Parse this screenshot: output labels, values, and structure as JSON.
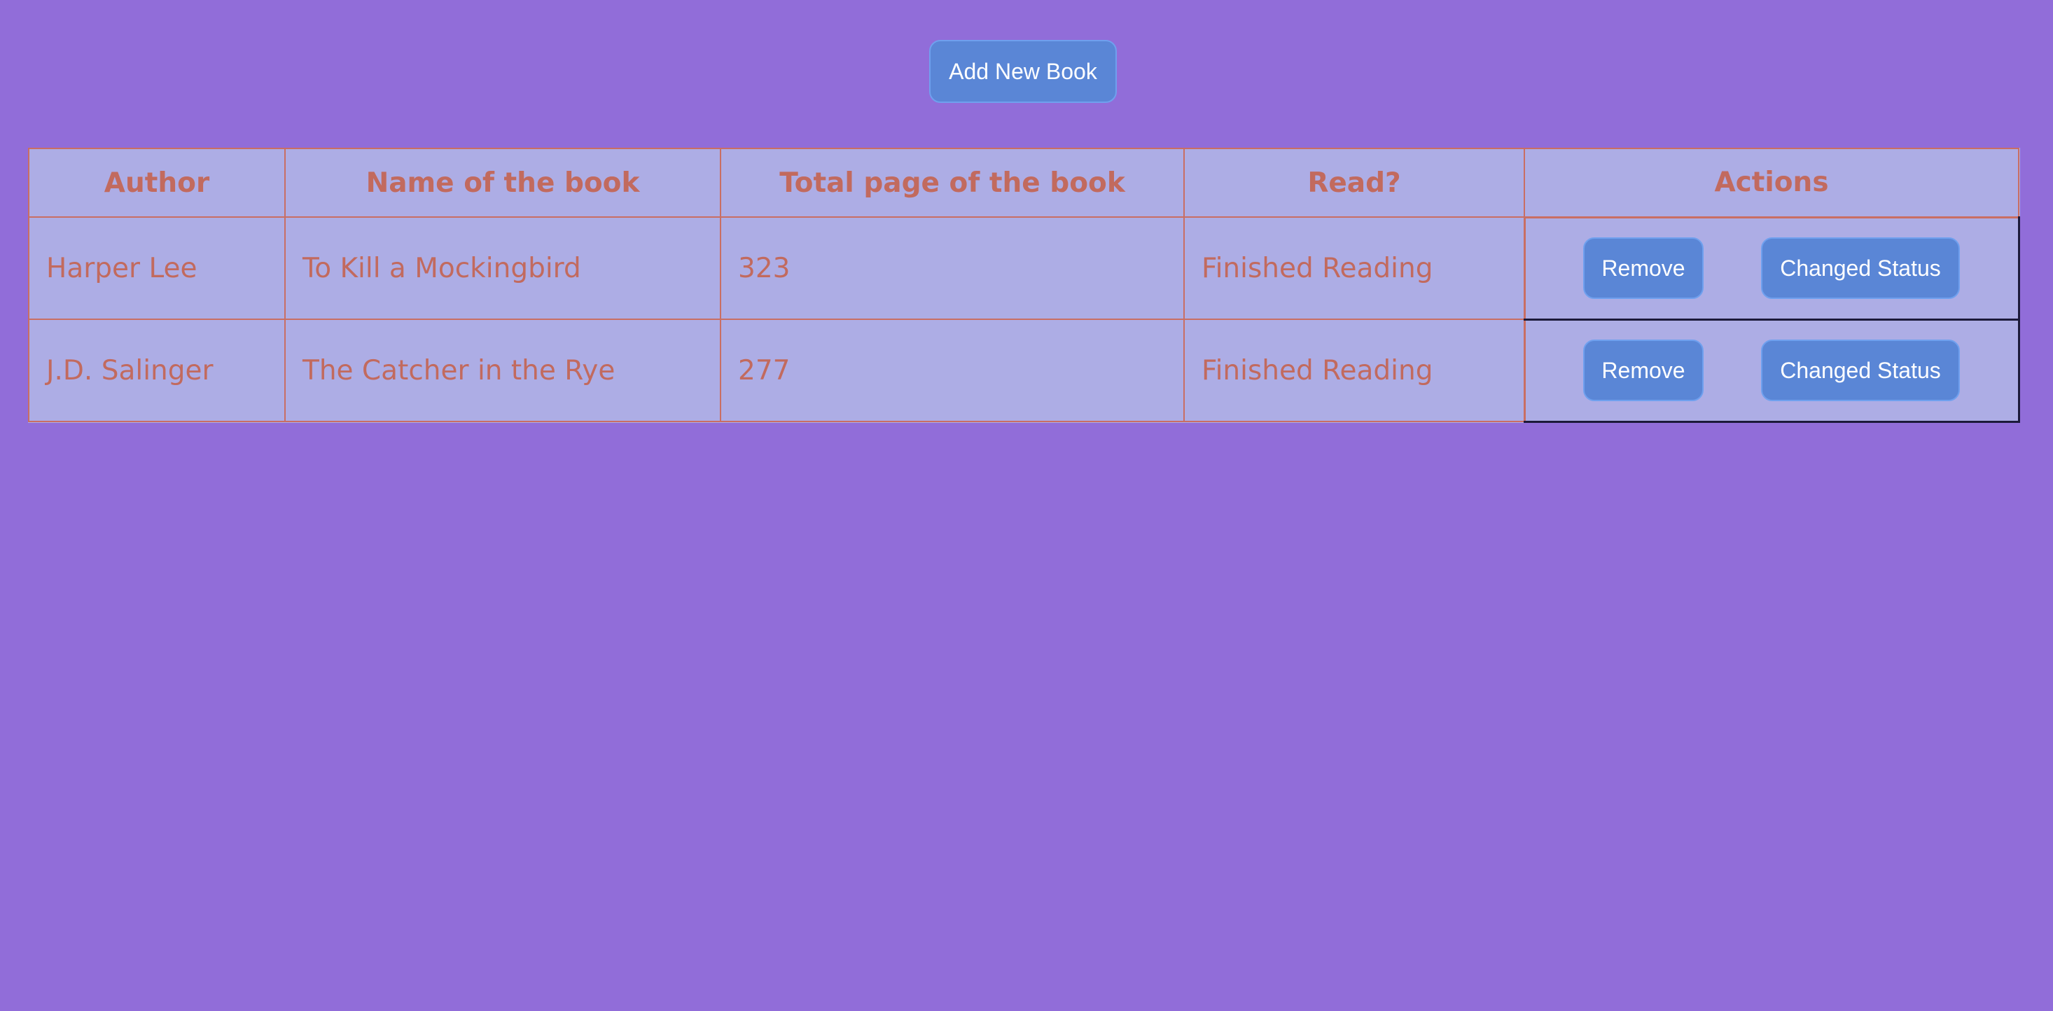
{
  "toolbar": {
    "add_button_label": "Add New Book"
  },
  "table": {
    "headers": [
      "Author",
      "Name of the book",
      "Total page of the book",
      "Read?",
      "Actions"
    ],
    "rows": [
      {
        "author": "Harper Lee",
        "title": "To Kill a Mockingbird",
        "pages": "323",
        "status": "Finished Reading",
        "remove_label": "Remove",
        "status_button_label": "Changed Status"
      },
      {
        "author": "J.D. Salinger",
        "title": "The Catcher in the Rye",
        "pages": "277",
        "status": "Finished Reading",
        "remove_label": "Remove",
        "status_button_label": "Changed Status"
      }
    ]
  },
  "colors": {
    "page_background": "#916dd9",
    "table_background": "#adade5",
    "table_text": "#c26a5e",
    "table_border": "#c96e63",
    "button_background": "#5a86d6",
    "button_text": "#ffffff"
  }
}
